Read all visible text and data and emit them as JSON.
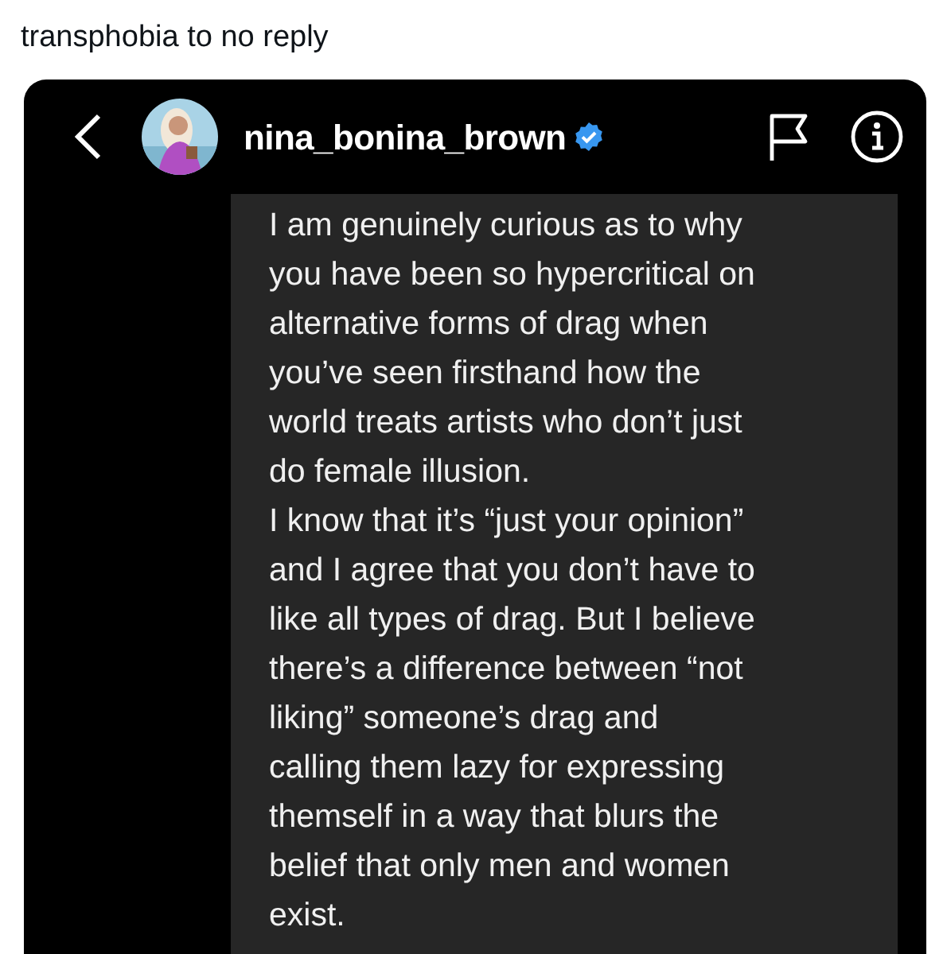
{
  "tweet_text": "transphobia to no reply",
  "dm": {
    "username": "nina_bonina_brown",
    "verified": true,
    "message": {
      "paragraphs": [
        {
          "lines": [
            "I am genuinely curious as to why",
            "you have been so hypercritical on",
            "alternative forms of drag when",
            "you’ve seen firsthand how the",
            "world treats artists who don’t just",
            "do female illusion."
          ]
        },
        {
          "lines": [
            "I know that it’s “just your opinion”",
            "and I agree that you don’t have to",
            "like all types of drag. But I believe",
            "there’s a difference between “not",
            "liking” someone’s drag and",
            "calling them lazy for expressing",
            "themself in a way that blurs the",
            "belief that only men and women",
            "exist."
          ]
        }
      ]
    }
  }
}
